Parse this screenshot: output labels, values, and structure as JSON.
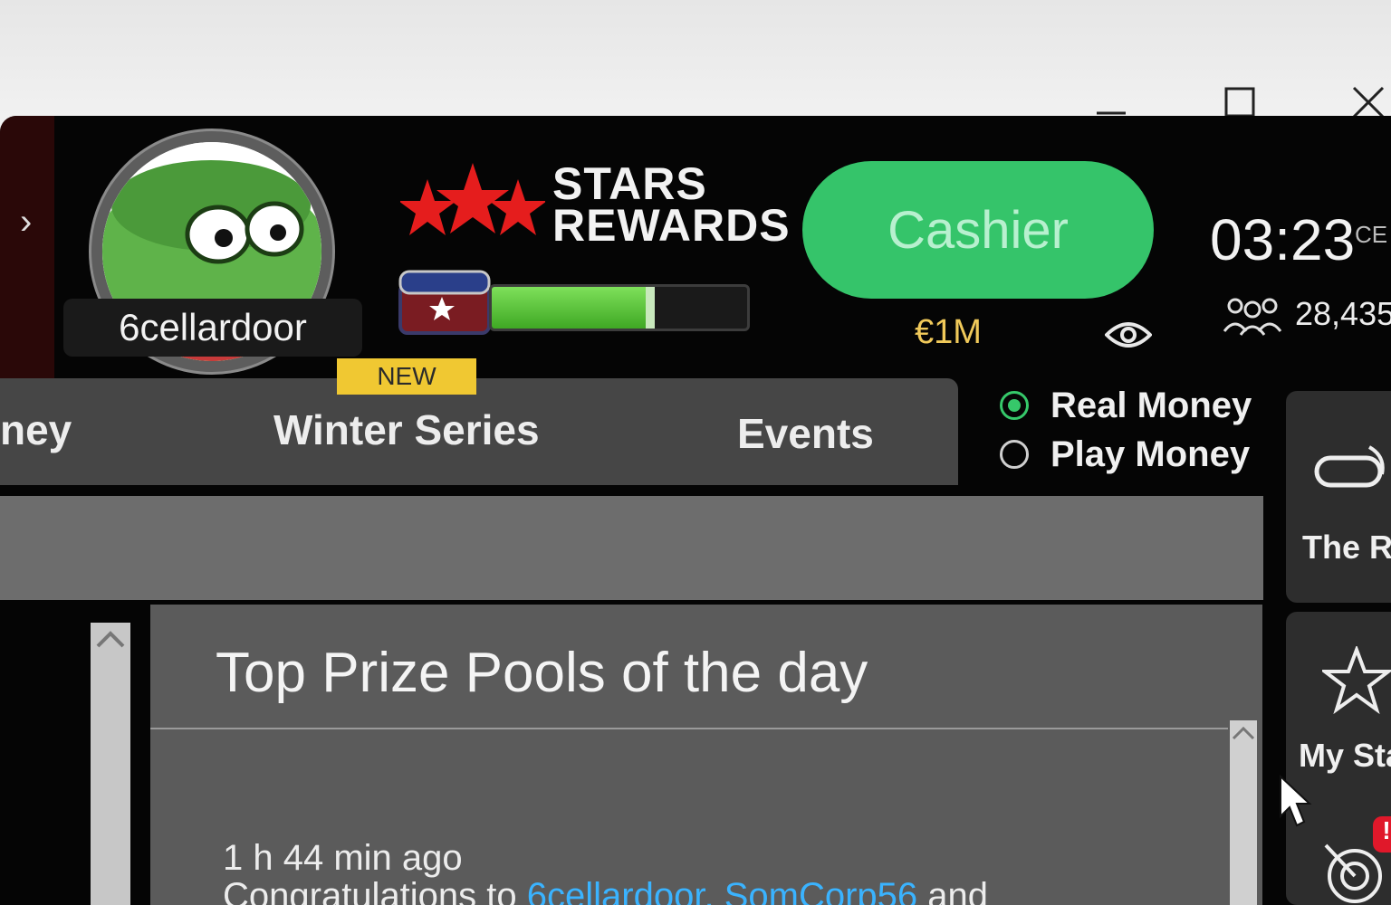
{
  "window": {
    "minimize_label": "minimize",
    "maximize_label": "maximize",
    "close_label": "close"
  },
  "rail": {
    "arrow": "›"
  },
  "profile": {
    "username": "6cellardoor"
  },
  "rewards": {
    "title_line1": "STARS",
    "title_line2": "REWARDS",
    "progress": 0.62
  },
  "cashier": {
    "label": "Cashier",
    "balance": "€1M"
  },
  "status": {
    "time": "03:23",
    "timezone": "CE",
    "players_online": "28,435"
  },
  "tabs": [
    {
      "label": "ney"
    },
    {
      "label": "Winter Series",
      "badge": "NEW"
    },
    {
      "label": "Events"
    }
  ],
  "money_mode": {
    "real": "Real Money",
    "play": "Play Money",
    "selected": "real"
  },
  "news": {
    "title": "Top Prize Pools of the day",
    "time": "1 h 44 min ago",
    "text_prefix": "Congratulations to",
    "link_text": "6cellardoor, SomCorp56",
    "text_suffix": "and"
  },
  "side_widgets": [
    {
      "label": "The Ra",
      "icon": "ring-icon"
    },
    {
      "label": "My Sta",
      "icon": "star-icon"
    },
    {
      "label": "",
      "icon": "target-icon",
      "alert": "!"
    }
  ],
  "colors": {
    "accent_green": "#35c46a",
    "balance_gold": "#f0c95a",
    "link_blue": "#3ab3ff",
    "badge_yellow": "#f0c832"
  }
}
